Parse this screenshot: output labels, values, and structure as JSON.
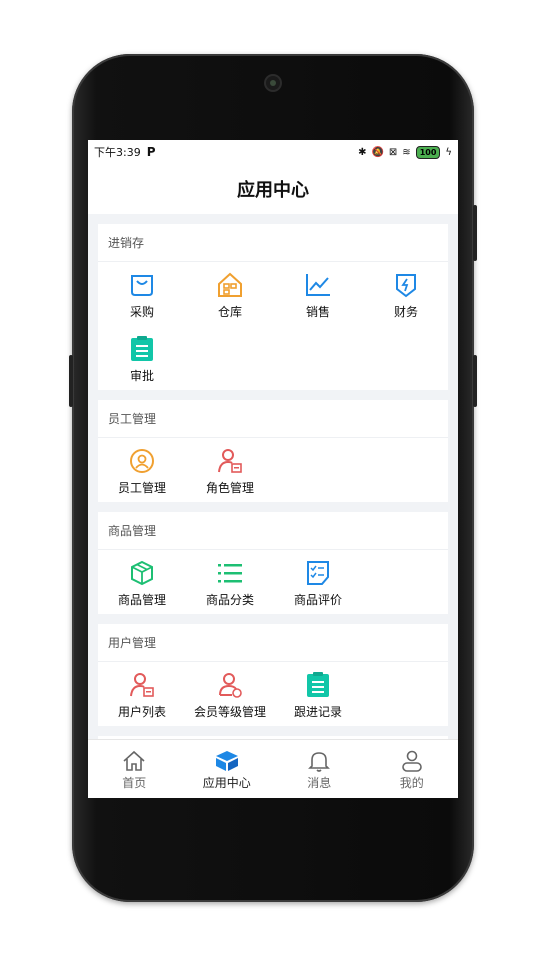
{
  "status": {
    "time": "下午3:39",
    "battery": "100"
  },
  "header": {
    "title": "应用中心"
  },
  "sections": [
    {
      "title": "进销存",
      "items": [
        {
          "label": "采购",
          "icon": "shopping-bag-icon"
        },
        {
          "label": "仓库",
          "icon": "warehouse-icon"
        },
        {
          "label": "销售",
          "icon": "sales-chart-icon"
        },
        {
          "label": "财务",
          "icon": "finance-icon"
        },
        {
          "label": "审批",
          "icon": "approval-clipboard-icon"
        }
      ]
    },
    {
      "title": "员工管理",
      "items": [
        {
          "label": "员工管理",
          "icon": "staff-icon"
        },
        {
          "label": "角色管理",
          "icon": "role-icon"
        }
      ]
    },
    {
      "title": "商品管理",
      "items": [
        {
          "label": "商品管理",
          "icon": "product-box-icon"
        },
        {
          "label": "商品分类",
          "icon": "category-list-icon"
        },
        {
          "label": "商品评价",
          "icon": "review-doc-icon"
        }
      ]
    },
    {
      "title": "用户管理",
      "items": [
        {
          "label": "用户列表",
          "icon": "user-list-icon"
        },
        {
          "label": "会员等级管理",
          "icon": "member-level-icon"
        },
        {
          "label": "跟进记录",
          "icon": "followup-clipboard-icon"
        }
      ]
    }
  ],
  "tabbar": [
    {
      "label": "首页",
      "icon": "home-icon"
    },
    {
      "label": "应用中心",
      "icon": "app-center-icon",
      "active": true
    },
    {
      "label": "消息",
      "icon": "bell-icon"
    },
    {
      "label": "我的",
      "icon": "profile-icon"
    }
  ],
  "colors": {
    "blue": "#1e88e5",
    "orange": "#f0a030",
    "red": "#e25a5a",
    "green": "#1dbf73",
    "teal": "#11c6a8"
  }
}
